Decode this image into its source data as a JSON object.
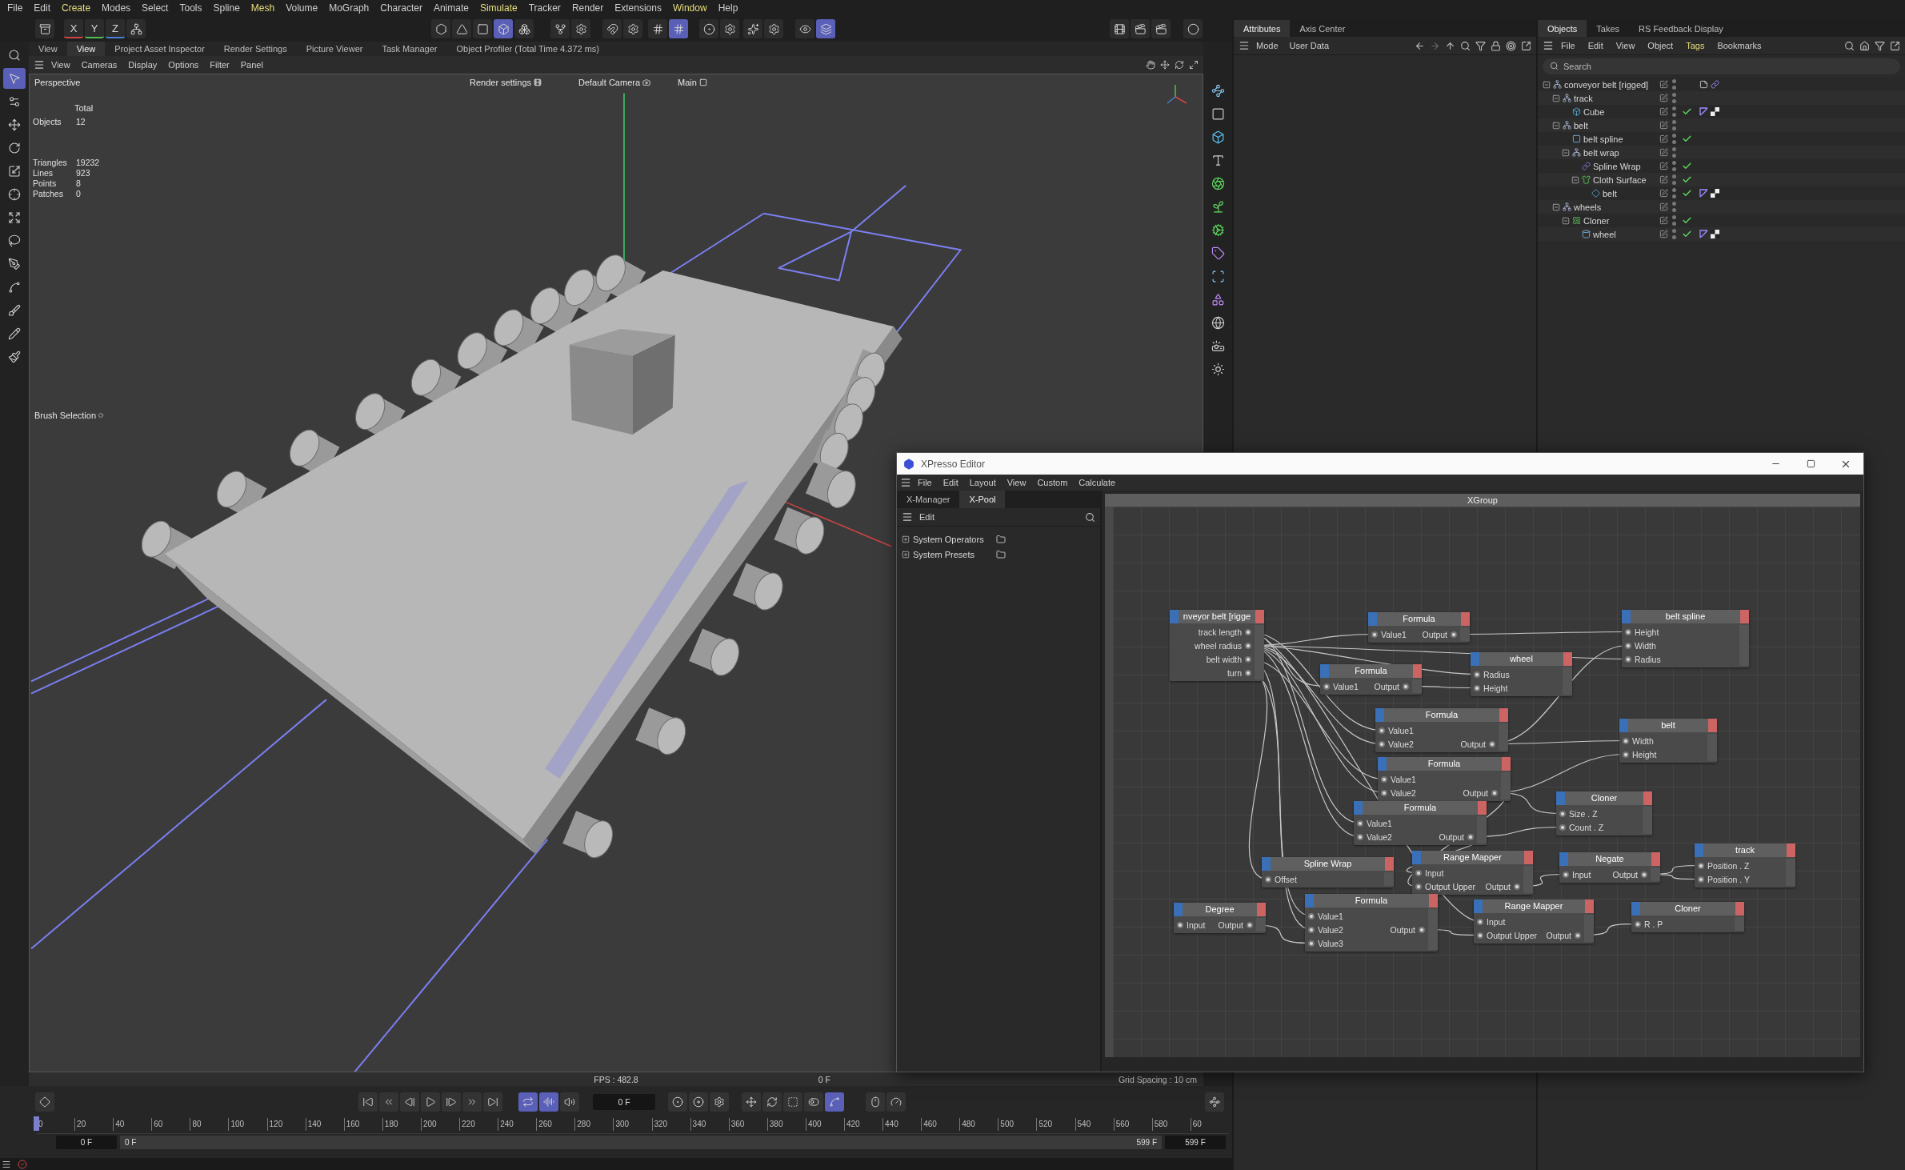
{
  "menu": [
    {
      "label": "File",
      "highlighted": false
    },
    {
      "label": "Edit",
      "highlighted": false
    },
    {
      "label": "Create",
      "highlighted": true
    },
    {
      "label": "Modes",
      "highlighted": false
    },
    {
      "label": "Select",
      "highlighted": false
    },
    {
      "label": "Tools",
      "highlighted": false
    },
    {
      "label": "Spline",
      "highlighted": false
    },
    {
      "label": "Mesh",
      "highlighted": true
    },
    {
      "label": "Volume",
      "highlighted": false
    },
    {
      "label": "MoGraph",
      "highlighted": false
    },
    {
      "label": "Character",
      "highlighted": false
    },
    {
      "label": "Animate",
      "highlighted": false
    },
    {
      "label": "Simulate",
      "highlighted": true
    },
    {
      "label": "Tracker",
      "highlighted": false
    },
    {
      "label": "Render",
      "highlighted": false
    },
    {
      "label": "Extensions",
      "highlighted": false
    },
    {
      "label": "Window",
      "highlighted": true
    },
    {
      "label": "Help",
      "highlighted": false
    }
  ],
  "toolbar": [
    {
      "kind": "icon",
      "selected": false
    },
    {
      "kind": "axis",
      "label": "X",
      "selected": false
    },
    {
      "kind": "axis",
      "label": "Y",
      "selected": false
    },
    {
      "kind": "axis",
      "label": "Z",
      "selected": false
    },
    {
      "kind": "icon",
      "selected": false
    },
    {
      "kind": "icon",
      "selected": false
    },
    {
      "kind": "icon",
      "selected": false
    },
    {
      "kind": "icon",
      "selected": false
    },
    {
      "kind": "icon",
      "selected": true
    },
    {
      "kind": "icon",
      "selected": false
    },
    {
      "kind": "icon",
      "selected": false
    },
    {
      "kind": "icon",
      "selected": false
    },
    {
      "kind": "icon",
      "selected": false
    },
    {
      "kind": "icon",
      "selected": false
    },
    {
      "kind": "icon",
      "selected": false
    },
    {
      "kind": "icon",
      "selected": true
    },
    {
      "kind": "icon",
      "selected": false
    },
    {
      "kind": "icon",
      "selected": false
    },
    {
      "kind": "icon",
      "selected": false
    },
    {
      "kind": "icon",
      "selected": false
    },
    {
      "kind": "icon",
      "selected": false
    },
    {
      "kind": "icon",
      "selected": true
    },
    {
      "kind": "icon",
      "selected": false
    },
    {
      "kind": "icon",
      "selected": false
    },
    {
      "kind": "icon",
      "selected": false
    },
    {
      "kind": "icon",
      "selected": false
    }
  ],
  "viewport_tabs": [
    {
      "label": "View",
      "selected": false
    },
    {
      "label": "View",
      "selected": true
    },
    {
      "label": "Project Asset Inspector",
      "selected": false
    },
    {
      "label": "Render Settings",
      "selected": false
    },
    {
      "label": "Picture Viewer",
      "selected": false
    },
    {
      "label": "Task Manager",
      "selected": false
    },
    {
      "label": "Object Profiler (Total Time 4.372 ms)",
      "selected": false
    }
  ],
  "viewport_menu": [
    "View",
    "Cameras",
    "Display",
    "Options",
    "Filter",
    "Panel"
  ],
  "left_tools": [
    {
      "selected": false
    },
    {
      "selected": true
    },
    {
      "selected": false
    },
    {
      "selected": false
    },
    {
      "selected": false
    },
    {
      "selected": false
    },
    {
      "selected": false
    },
    {
      "selected": false
    },
    {
      "selected": false
    },
    {
      "selected": false
    },
    {
      "selected": false
    },
    {
      "selected": false
    },
    {
      "selected": false
    },
    {
      "selected": false
    }
  ],
  "right_tools": [
    {
      "selected": false
    },
    {
      "selected": false
    },
    {
      "selected": false
    },
    {
      "selected": false
    },
    {
      "selected": false
    },
    {
      "selected": false
    },
    {
      "selected": false
    },
    {
      "selected": false
    },
    {
      "selected": false
    },
    {
      "selected": false
    },
    {
      "selected": false
    },
    {
      "selected": false
    },
    {
      "selected": false
    }
  ],
  "viewport": {
    "camera": "Perspective",
    "render_settings": "Render settings",
    "camera_name": "Default Camera",
    "layer": "Main",
    "stats_title": "Total",
    "object_stats": [
      {
        "label": "Objects",
        "value": "12"
      }
    ],
    "geometry_stats": [
      {
        "label": "Triangles",
        "value": "19232"
      },
      {
        "label": "Lines",
        "value": "923"
      },
      {
        "label": "Points",
        "value": "8"
      },
      {
        "label": "Patches",
        "value": "0"
      }
    ],
    "brush_tool": "Brush Selection",
    "fps": "FPS : 482.8",
    "frame": "0 F",
    "grid_spacing": "Grid Spacing : 10 cm"
  },
  "timeline": {
    "controls": [
      {
        "kind": "button",
        "selected": false
      },
      {
        "kind": "button",
        "selected": false
      },
      {
        "kind": "button",
        "selected": false
      },
      {
        "kind": "button",
        "selected": false
      },
      {
        "kind": "button",
        "selected": false
      },
      {
        "kind": "button",
        "selected": false
      },
      {
        "kind": "button",
        "selected": false
      },
      {
        "kind": "button",
        "selected": false
      },
      {
        "kind": "button",
        "selected": true
      },
      {
        "kind": "button",
        "selected": true
      },
      {
        "kind": "button",
        "selected": false
      },
      {
        "kind": "field",
        "value": "0 F"
      },
      {
        "kind": "button",
        "selected": false
      },
      {
        "kind": "button",
        "selected": false
      },
      {
        "kind": "button",
        "selected": false
      },
      {
        "kind": "button",
        "selected": false
      },
      {
        "kind": "button",
        "selected": false
      },
      {
        "kind": "button",
        "selected": false
      },
      {
        "kind": "button",
        "selected": false
      },
      {
        "kind": "button",
        "selected": true
      },
      {
        "kind": "button",
        "selected": false
      },
      {
        "kind": "button",
        "selected": false
      },
      {
        "kind": "button",
        "selected": false
      }
    ],
    "ruler": [
      "0",
      "20",
      "40",
      "60",
      "80",
      "100",
      "120",
      "140",
      "160",
      "180",
      "200",
      "220",
      "240",
      "260",
      "280",
      "300",
      "320",
      "340",
      "360",
      "380",
      "400",
      "420",
      "440",
      "460",
      "480",
      "500",
      "520",
      "540",
      "560",
      "580",
      "60"
    ],
    "start_field": "0 F",
    "range_start": "0 F",
    "range_end": "599 F",
    "end_field": "599 F"
  },
  "attributes": {
    "tabs": [
      {
        "label": "Attributes",
        "selected": true
      },
      {
        "label": "Axis Center",
        "selected": false
      }
    ],
    "menu": [
      "Mode",
      "User Data"
    ]
  },
  "objects": {
    "tabs": [
      {
        "label": "Objects",
        "selected": true
      },
      {
        "label": "Takes",
        "selected": false
      },
      {
        "label": "RS Feedback Display",
        "selected": false
      }
    ],
    "menu": [
      {
        "label": "File",
        "highlighted": false
      },
      {
        "label": "Edit",
        "highlighted": false
      },
      {
        "label": "View",
        "highlighted": false
      },
      {
        "label": "Object",
        "highlighted": false
      },
      {
        "label": "Tags",
        "highlighted": true
      },
      {
        "label": "Bookmarks",
        "highlighted": false
      }
    ],
    "search": {
      "placeholder": "Search"
    },
    "tree": [
      {
        "name": "conveyor belt [rigged]",
        "kind": "null",
        "expanded": true,
        "checked": false,
        "tags": [
          {
            "kind": "note"
          },
          {
            "kind": "link"
          }
        ],
        "children": [
          {
            "name": "track",
            "kind": "null",
            "expanded": true,
            "checked": false,
            "children": [
              {
                "name": "Cube",
                "kind": "cube",
                "checked": true,
                "tags": [
                  {
                    "kind": "phong"
                  },
                  {
                    "kind": "material"
                  }
                ]
              }
            ]
          },
          {
            "name": "belt",
            "kind": "null",
            "expanded": true,
            "checked": false,
            "children": [
              {
                "name": "belt spline",
                "kind": "spline",
                "checked": true
              },
              {
                "name": "belt wrap",
                "kind": "null",
                "expanded": true,
                "checked": false,
                "children": [
                  {
                    "name": "Spline Wrap",
                    "kind": "deformer",
                    "checked": true
                  },
                  {
                    "name": "Cloth Surface",
                    "kind": "cloth",
                    "expanded": true,
                    "checked": true,
                    "children": [
                      {
                        "name": "belt",
                        "kind": "polygon",
                        "checked": true,
                        "tags": [
                          {
                            "kind": "phong"
                          },
                          {
                            "kind": "material"
                          }
                        ]
                      }
                    ]
                  }
                ]
              }
            ]
          },
          {
            "name": "wheels",
            "kind": "null",
            "expanded": true,
            "checked": false,
            "children": [
              {
                "name": "Cloner",
                "kind": "cloner",
                "expanded": true,
                "checked": true,
                "children": [
                  {
                    "name": "wheel",
                    "kind": "cylinder",
                    "checked": true,
                    "tags": [
                      {
                        "kind": "phong"
                      },
                      {
                        "kind": "material"
                      }
                    ]
                  }
                ]
              }
            ]
          }
        ]
      }
    ]
  },
  "xpresso": {
    "title": "XPresso Editor",
    "menu": [
      "File",
      "Edit",
      "Layout",
      "View",
      "Custom",
      "Calculate"
    ],
    "tabs": [
      {
        "label": "X-Manager",
        "selected": false
      },
      {
        "label": "X-Pool",
        "selected": true
      }
    ],
    "pool_menu": "Edit",
    "pool_items": [
      {
        "label": "System Operators",
        "expanded": false
      },
      {
        "label": "System Presets",
        "expanded": false
      }
    ],
    "canvas_title": "XGroup",
    "nodes": [
      {
        "title": "nveyor belt [rigge",
        "outputs": [
          "track length",
          "wheel radius",
          "belt width",
          "turn"
        ]
      },
      {
        "title": "Formula",
        "inputs": [
          "Value1"
        ],
        "outputs": [
          "Output"
        ]
      },
      {
        "title": "belt spline",
        "inputs": [
          "Height",
          "Width",
          "Radius"
        ]
      },
      {
        "title": "Formula",
        "inputs": [
          "Value1"
        ],
        "outputs": [
          "Output"
        ]
      },
      {
        "title": "wheel",
        "inputs": [
          "Radius",
          "Height"
        ]
      },
      {
        "title": "Formula",
        "inputs": [
          "Value1",
          "Value2"
        ],
        "outputs": [
          "Output"
        ]
      },
      {
        "title": "belt",
        "inputs": [
          "Width",
          "Height"
        ]
      },
      {
        "title": "Formula",
        "inputs": [
          "Value1",
          "Value2"
        ],
        "outputs": [
          "Output"
        ]
      },
      {
        "title": "Cloner",
        "inputs": [
          "Size . Z",
          "Count . Z"
        ]
      },
      {
        "title": "Formula",
        "inputs": [
          "Value1",
          "Value2"
        ],
        "outputs": [
          "Output"
        ]
      },
      {
        "title": "Spline Wrap",
        "inputs": [
          "Offset"
        ]
      },
      {
        "title": "Range Mapper",
        "inputs": [
          "Input",
          "Output Upper"
        ],
        "outputs": [
          "Output"
        ]
      },
      {
        "title": "Negate",
        "inputs": [
          "Input"
        ],
        "outputs": [
          "Output"
        ]
      },
      {
        "title": "track",
        "inputs": [
          "Position . Z",
          "Position . Y"
        ]
      },
      {
        "title": "Degree",
        "inputs": [
          "Input"
        ],
        "outputs": [
          "Output"
        ]
      },
      {
        "title": "Formula",
        "inputs": [
          "Value1",
          "Value2",
          "Value3"
        ],
        "outputs": [
          "Output"
        ]
      },
      {
        "title": "Range Mapper",
        "inputs": [
          "Input",
          "Output Upper"
        ],
        "outputs": [
          "Output"
        ]
      },
      {
        "title": "Cloner",
        "inputs": [
          "R . P"
        ]
      }
    ]
  }
}
